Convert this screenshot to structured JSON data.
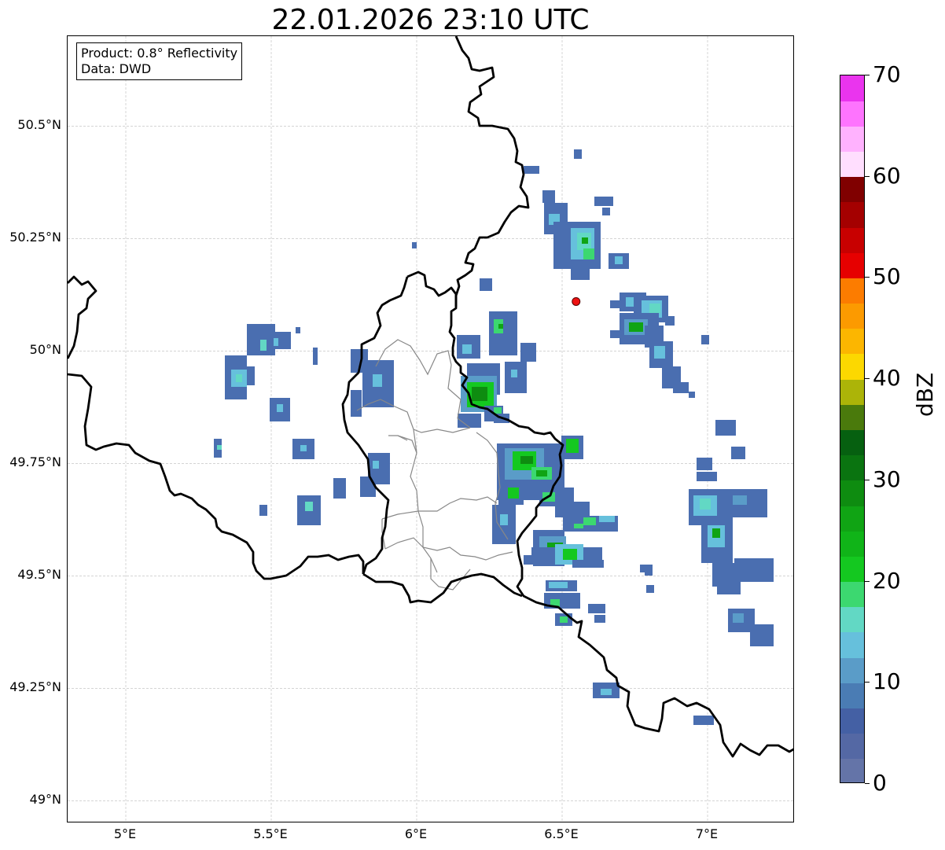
{
  "title": "22.01.2026 23:10 UTC",
  "info": {
    "product": "Product: 0.8° Reflectivity",
    "data": "Data: DWD"
  },
  "map": {
    "lon_range": [
      4.8,
      7.3
    ],
    "lat_range": [
      48.95,
      50.7
    ],
    "grid": true,
    "lat_ticks": [
      {
        "value": 49.0,
        "label": "49°N"
      },
      {
        "value": 49.25,
        "label": "49.25°N"
      },
      {
        "value": 49.5,
        "label": "49.5°N"
      },
      {
        "value": 49.75,
        "label": "49.75°N"
      },
      {
        "value": 50.0,
        "label": "50°N"
      },
      {
        "value": 50.25,
        "label": "50.25°N"
      },
      {
        "value": 50.5,
        "label": "50.5°N"
      }
    ],
    "lon_ticks": [
      {
        "value": 5.0,
        "label": "5°E"
      },
      {
        "value": 5.5,
        "label": "5.5°E"
      },
      {
        "value": 6.0,
        "label": "6°E"
      },
      {
        "value": 6.5,
        "label": "6.5°E"
      },
      {
        "value": 7.0,
        "label": "7°E"
      }
    ],
    "radar_site": {
      "lon": 6.548,
      "lat": 50.11,
      "color": "#ee1111"
    },
    "country_border_color": "#000000",
    "district_border_color": "#888888"
  },
  "colorbar": {
    "label": "dBZ",
    "min": 0,
    "max": 70,
    "ticks": [
      "0",
      "10",
      "20",
      "30",
      "40",
      "50",
      "60",
      "70"
    ],
    "colors": [
      "#6474a8",
      "#5468a4",
      "#4460a4",
      "#4a7cb4",
      "#5a9cc8",
      "#66c0dc",
      "#62d8c4",
      "#3cd870",
      "#14c820",
      "#10b418",
      "#10a414",
      "#0e8c10",
      "#0a7410",
      "#066010",
      "#4a7a0c",
      "#acb408",
      "#fcd800",
      "#fcb600",
      "#fc9a00",
      "#fc7c00",
      "#e60000",
      "#c80000",
      "#a40000",
      "#800000",
      "#ffdefe",
      "#ffb2fe",
      "#fe74fe",
      "#ea34ee"
    ]
  }
}
